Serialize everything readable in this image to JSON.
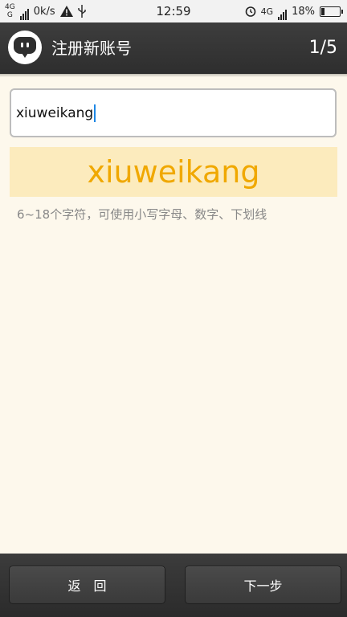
{
  "status_bar": {
    "network_top": "4G",
    "network_bottom": "G",
    "speed": "0k/s",
    "time": "12:59",
    "network_type": "4G",
    "battery": "18%"
  },
  "header": {
    "title": "注册新账号",
    "step": "1/5"
  },
  "form": {
    "username_value": "xiuweikang",
    "preview_text": "xiuweikang",
    "hint": "6~18个字符，可使用小写字母、数字、下划线"
  },
  "footer": {
    "back_label": "返　回",
    "next_label": "下一步"
  },
  "colors": {
    "accent": "#f0a800",
    "preview_bg": "#fcebbd",
    "page_bg": "#fdf8ec",
    "header_bg": "#333333",
    "caret": "#1e88e5"
  }
}
